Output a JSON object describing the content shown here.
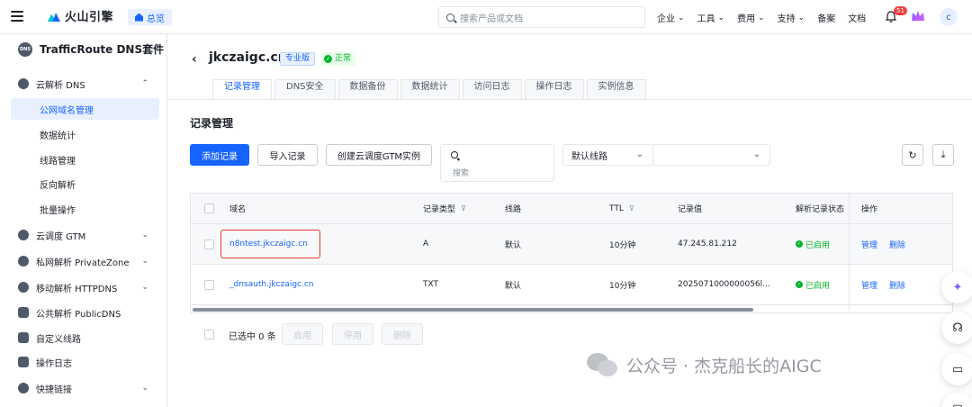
{
  "topbar": {
    "brand": "火山引擎",
    "home_label": "总览",
    "search_placeholder": "搜索产品或文档",
    "nav": [
      "企业",
      "工具",
      "费用",
      "支持",
      "备案",
      "文档"
    ],
    "notification_count": "51",
    "avatar_letter": "c"
  },
  "sidebar": {
    "product_title": "TrafficRoute DNS套件",
    "product_icon_text": "DNS",
    "groups": [
      {
        "label": "云解析 DNS",
        "expanded": true
      },
      {
        "label": "云调度 GTM"
      },
      {
        "label": "私网解析 PrivateZone"
      },
      {
        "label": "移动解析 HTTPDNS"
      },
      {
        "label": "公共解析 PublicDNS"
      },
      {
        "label": "自定义线路"
      },
      {
        "label": "操作日志"
      },
      {
        "label": "快捷链接"
      }
    ],
    "dns_children": [
      "公网域名管理",
      "数据统计",
      "线路管理",
      "反向解析",
      "批量操作"
    ]
  },
  "header": {
    "domain": "jkczaigc.cn",
    "plan_tag": "专业版",
    "status_tag": "正常"
  },
  "tabs": [
    "记录管理",
    "DNS安全",
    "数据备份",
    "数据统计",
    "访问日志",
    "操作日志",
    "实例信息"
  ],
  "section_title": "记录管理",
  "toolbar": {
    "add": "添加记录",
    "import": "导入记录",
    "create_gtm": "创建云调度GTM实例",
    "search_placeholder": "搜索",
    "line_select": "默认线路"
  },
  "table": {
    "columns": [
      "域名",
      "记录类型",
      "线路",
      "TTL",
      "记录值",
      "解析记录状态",
      "操作"
    ],
    "rows": [
      {
        "name": "n8ntest.jkczaigc.cn",
        "type": "A",
        "line": "默认",
        "ttl": "10分钟",
        "value": "47.245.81.212",
        "status": "已启用",
        "manage": "管理",
        "delete": "删除"
      },
      {
        "name": "_dnsauth.jkczaigc.cn",
        "type": "TXT",
        "line": "默认",
        "ttl": "10分钟",
        "value": "2025071000000056l...",
        "status": "已启用",
        "manage": "管理",
        "delete": "删除"
      }
    ]
  },
  "footer": {
    "selected": "已选中 0 条",
    "enable": "启用",
    "disable": "停用",
    "delete": "删除"
  },
  "watermark": "公众号 · 杰克船长的AIGC",
  "colors": {
    "primary": "#1664ff",
    "success": "#00b42a",
    "highlight": "#e5382d"
  }
}
